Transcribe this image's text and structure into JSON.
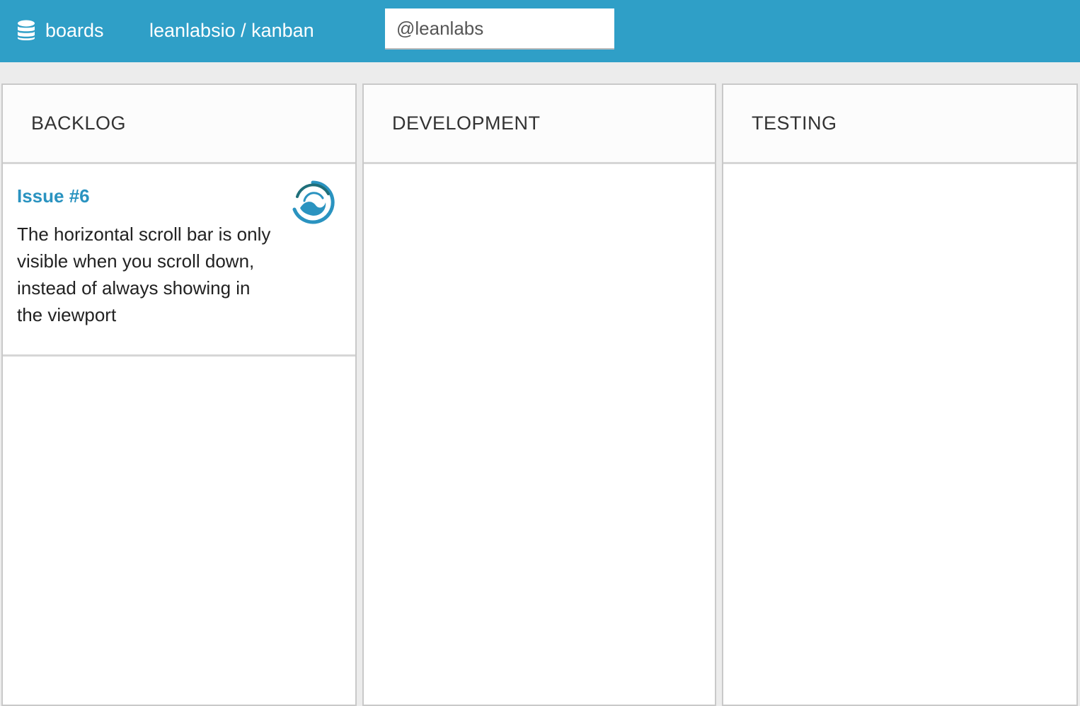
{
  "header": {
    "brand_label": "boards",
    "brand_icon": "database-icon",
    "repo_path": "leanlabsio / kanban",
    "search_value": "@leanlabs",
    "background_color": "#2f9fc7"
  },
  "columns": [
    {
      "title": "BACKLOG"
    },
    {
      "title": "DEVELOPMENT"
    },
    {
      "title": "TESTING"
    }
  ],
  "cards": [
    {
      "title": "Issue #6",
      "description": "The horizontal scroll bar is only visible when you scroll down, instead of always showing in the viewport",
      "avatar_icon": "avatar-wave-icon"
    }
  ]
}
